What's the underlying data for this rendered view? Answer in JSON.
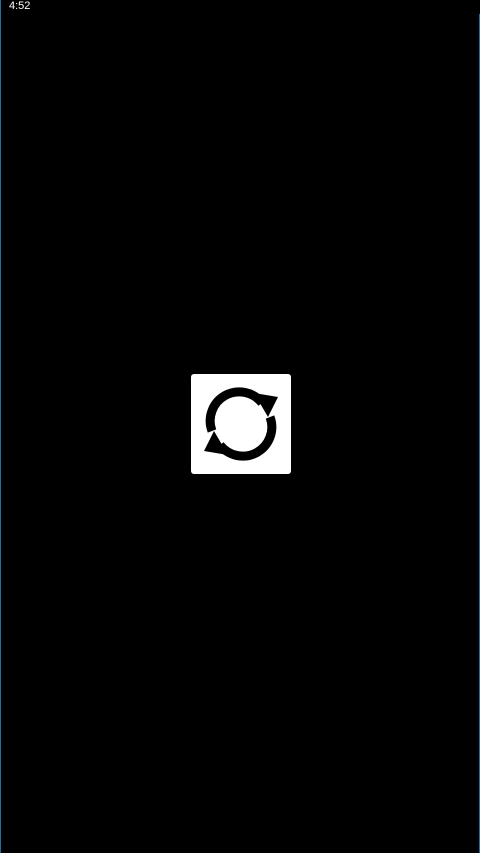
{
  "status_bar": {
    "time": "4:52"
  },
  "main": {
    "refresh_button": {
      "icon": "refresh-icon",
      "background_color": "#ffffff",
      "icon_color": "#000000"
    }
  },
  "colors": {
    "background": "#000000",
    "edge_accent": "#1a6fa8"
  }
}
